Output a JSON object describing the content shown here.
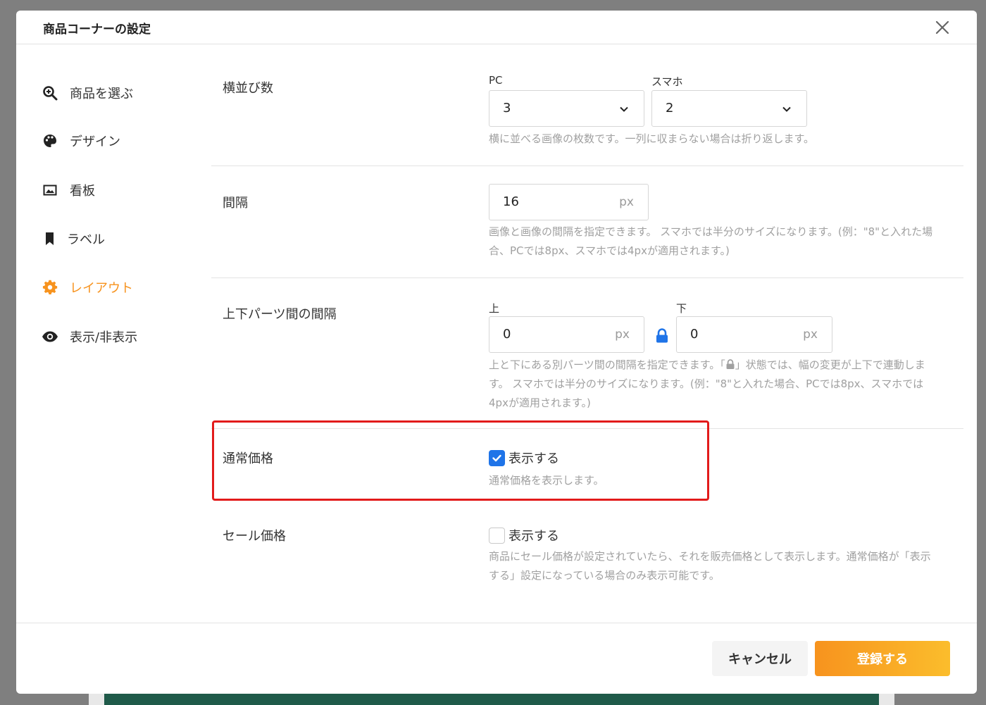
{
  "modal": {
    "title": "商品コーナーの設定"
  },
  "sidebar": {
    "items": [
      {
        "label": "商品を選ぶ",
        "icon": "zoom-in-icon"
      },
      {
        "label": "デザイン",
        "icon": "palette-icon"
      },
      {
        "label": "看板",
        "icon": "image-icon"
      },
      {
        "label": "ラベル",
        "icon": "bookmark-icon"
      },
      {
        "label": "レイアウト",
        "icon": "gear-icon",
        "active": true
      },
      {
        "label": "表示/非表示",
        "icon": "eye-icon"
      }
    ]
  },
  "sections": {
    "columns": {
      "label": "横並び数",
      "pc_label": "PC",
      "pc_value": "3",
      "sp_label": "スマホ",
      "sp_value": "2",
      "help": "横に並べる画像の枚数です。一列に収まらない場合は折り返します。"
    },
    "gap": {
      "label": "間隔",
      "value": "16",
      "unit": "px",
      "help_line1": "画像と画像の間隔を指定できます。 スマホでは半分のサイズになります。(例：\"8\"と入れた場",
      "help_line2": "合、PCでは8px、スマホでは4pxが適用されます。)"
    },
    "part_gap": {
      "label": "上下パーツ間の間隔",
      "top_label": "上",
      "top_value": "0",
      "bottom_label": "下",
      "bottom_value": "0",
      "unit": "px",
      "help_line1_a": "上と下にある別パーツ間の間隔を指定できます。「",
      "help_line1_b": "」状態では、幅の変更が上下で連動しま",
      "help_line2": "す。 スマホでは半分のサイズになります。(例：\"8\"と入れた場合、PCでは8px、スマホでは",
      "help_line3": "4pxが適用されます。)"
    },
    "regular_price": {
      "label": "通常価格",
      "checkbox_label": "表示する",
      "checked": true,
      "help": "通常価格を表示します。"
    },
    "sale_price": {
      "label": "セール価格",
      "checkbox_label": "表示する",
      "checked": false,
      "help_line1": "商品にセール価格が設定されていたら、それを販売価格として表示します。通常価格が「表示",
      "help_line2": "する」設定になっている場合のみ表示可能です。"
    }
  },
  "footer": {
    "cancel_label": "キャンセル",
    "submit_label": "登録する"
  },
  "colors": {
    "accent": "#f7931e",
    "checkbox": "#1f74e8",
    "highlight": "#e21b1b"
  }
}
